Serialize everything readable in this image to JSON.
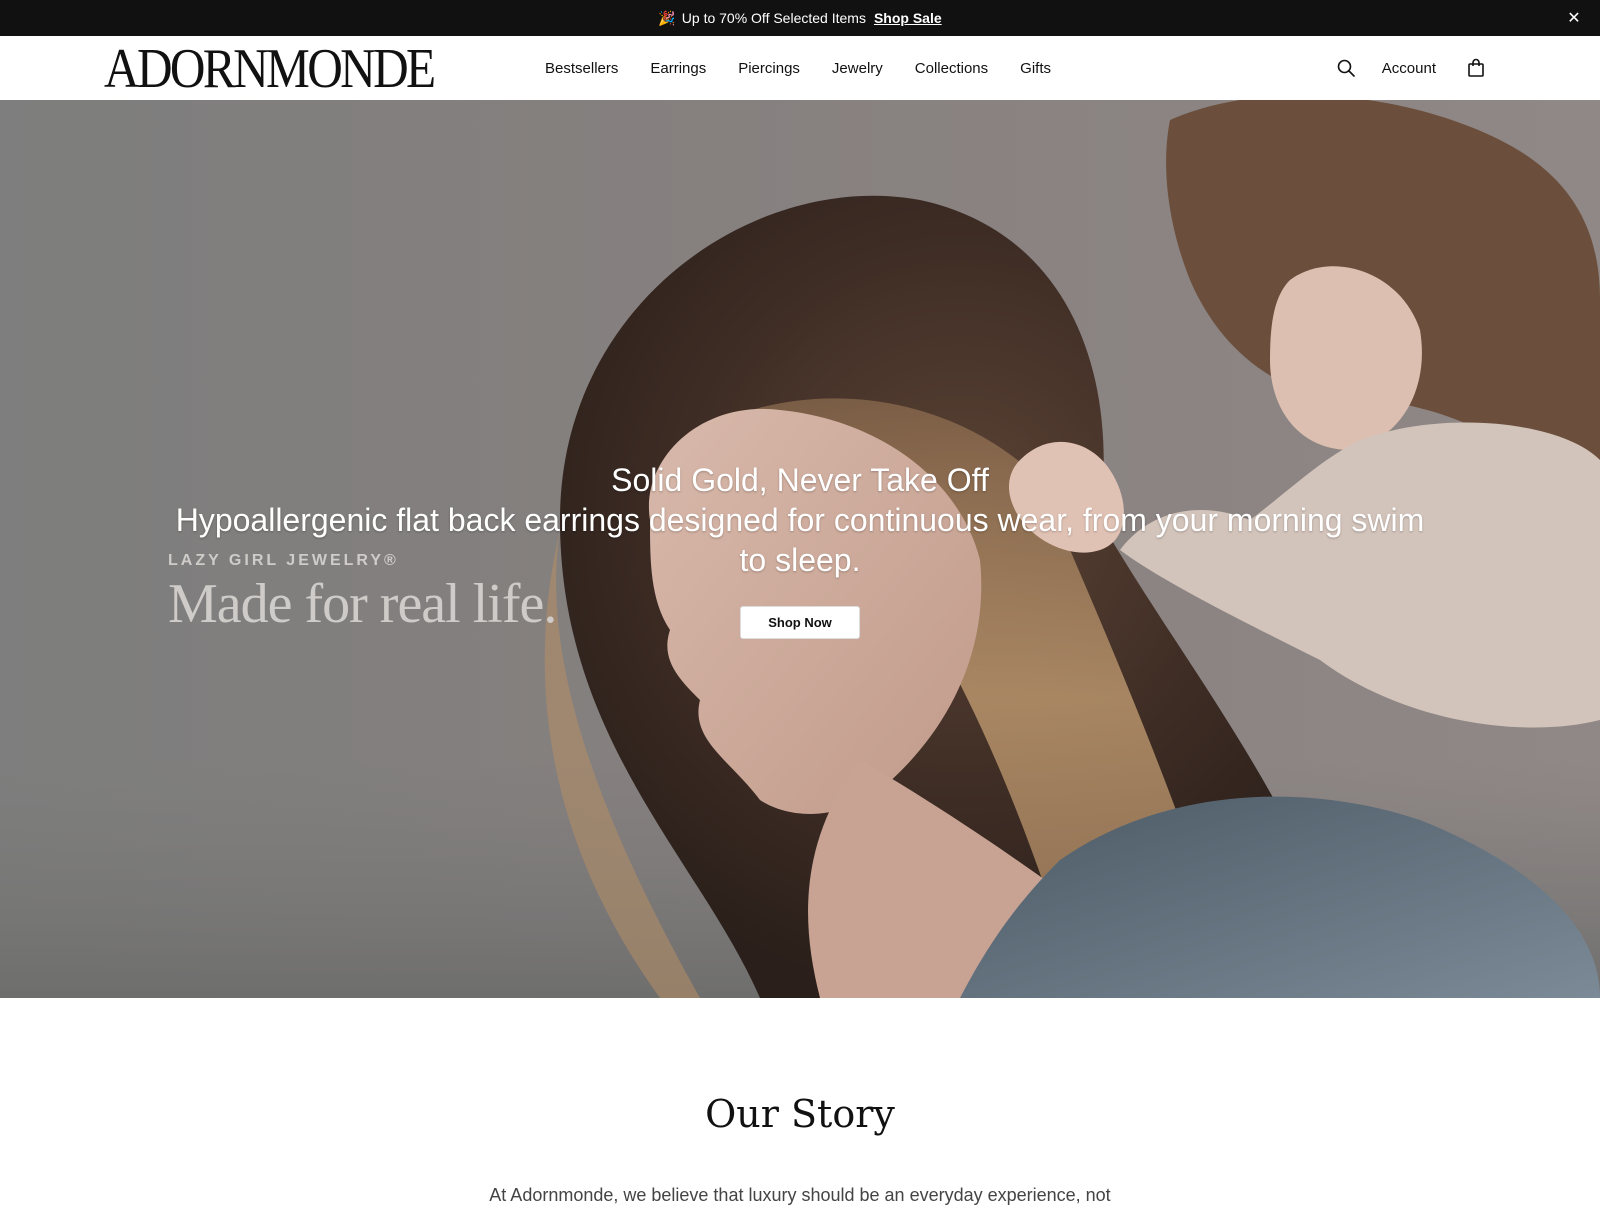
{
  "announcement": {
    "emoji": "🎉",
    "text": "Up to 70% Off Selected Items",
    "link": "Shop Sale",
    "close": "✕"
  },
  "header": {
    "logo": "ADORNMONDE",
    "nav": [
      "Bestsellers",
      "Earrings",
      "Piercings",
      "Jewelry",
      "Collections",
      "Gifts"
    ],
    "account": "Account"
  },
  "hero": {
    "title": "Solid Gold, Never Take Off",
    "subtitle": "Hypoallergenic flat back earrings designed for continuous wear, from your morning swim to sleep.",
    "button": "Shop Now",
    "overlay_small": "LAZY GIRL JEWELRY®",
    "overlay_big": "Made for real life."
  },
  "story": {
    "title": "Our Story",
    "text": "At Adornmonde, we believe that luxury should be an everyday experience, not"
  }
}
